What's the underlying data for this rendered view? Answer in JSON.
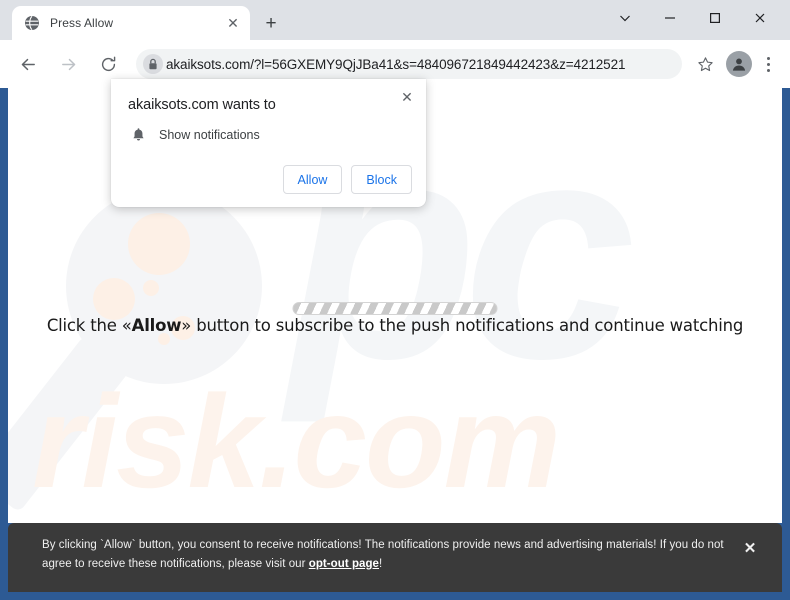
{
  "browser": {
    "tab": {
      "title": "Press Allow",
      "favicon": "globe-icon",
      "close_label": "✕"
    },
    "new_tab_label": "+",
    "window_controls": {
      "tab_search": "tab-search-chevron",
      "minimize": "—",
      "maximize": "□",
      "close": "✕"
    },
    "toolbar": {
      "back": "back-arrow",
      "forward": "forward-arrow",
      "reload": "reload-arrow",
      "url": "akaiksots.com/?l=56GXEMY9QjJBa41&s=484096721849442423&z=4212521",
      "lock": "lock-icon",
      "bookmark": "star-icon",
      "profile": "profile-avatar",
      "menu": "three-dot-menu"
    }
  },
  "permission_dialog": {
    "title": "akaiksots.com wants to",
    "permission_icon": "bell-icon",
    "permission_label": "Show notifications",
    "allow_label": "Allow",
    "block_label": "Block",
    "close_label": "✕"
  },
  "page": {
    "watermark_pc": "pc",
    "watermark_risk": "risk.com",
    "message_prefix": "Click the «",
    "message_bold": "Allow",
    "message_suffix": "» button to subscribe to the push notifications and continue watching",
    "progress_label": "striped-progress-bar"
  },
  "consent_banner": {
    "text_before_link": "By clicking `Allow` button, you consent to receive notifications! The notifications provide news and advertising materials! If you do not agree to receive these notifications, please visit our ",
    "link_label": "opt-out page",
    "text_after_link": "!",
    "close_label": "✕"
  },
  "colors": {
    "window_frame": "#2d5a94",
    "tabstrip": "#dee1e6",
    "toolbar": "#ffffff",
    "omnibox": "#f1f3f4",
    "accent_blue": "#1a73e8",
    "banner_bg": "#3a3a3a",
    "watermark_pc": "#f4f6f8",
    "watermark_risk": "#fdf3ec"
  }
}
